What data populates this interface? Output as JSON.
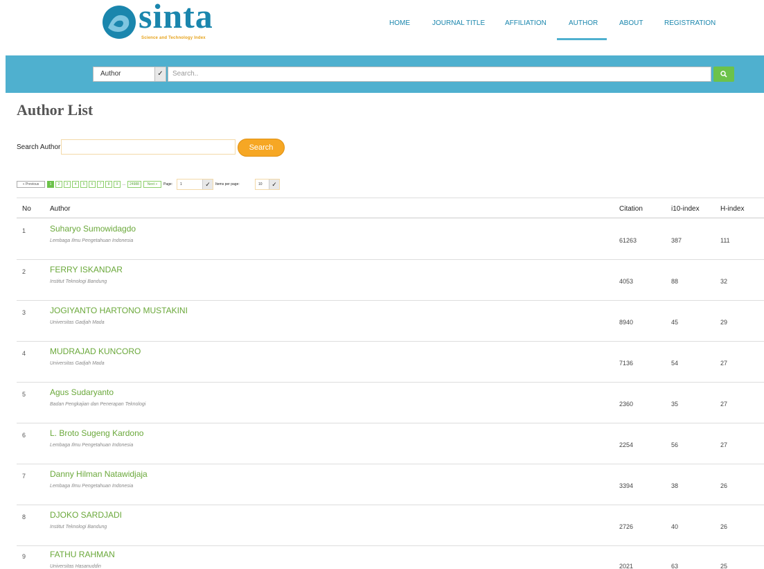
{
  "brand": {
    "name": "sinta",
    "tagline": "Science and Technology Index"
  },
  "nav": [
    "HOME",
    "JOURNAL TITLE",
    "AFFILIATION",
    "AUTHOR",
    "ABOUT",
    "REGISTRATION"
  ],
  "search_bar": {
    "scope": "Author",
    "placeholder": "Search.."
  },
  "page_title": "Author List",
  "search_author": {
    "label": "Search Author",
    "button": "Search"
  },
  "pagination": {
    "prev": "« Previous",
    "pages": [
      "1",
      "2",
      "3",
      "4",
      "5",
      "6",
      "7",
      "8",
      "9"
    ],
    "ellipsis": "...",
    "last": "24988",
    "next": "Next »",
    "page_label": "Page:",
    "page_value": "1",
    "per_page_label": "Items per page:",
    "per_page_value": "10"
  },
  "table": {
    "headers": {
      "no": "No",
      "author": "Author",
      "citation": "Citation",
      "i10": "i10-index",
      "h": "H-index"
    },
    "rows": [
      {
        "no": "1",
        "name": "Suharyo Sumowidagdo",
        "affiliation": "Lembaga Ilmu Pengetahuan Indonesia",
        "citation": "61263",
        "i10": "387",
        "h": "111"
      },
      {
        "no": "2",
        "name": "FERRY ISKANDAR",
        "affiliation": "Institut Teknologi Bandung",
        "citation": "4053",
        "i10": "88",
        "h": "32"
      },
      {
        "no": "3",
        "name": "JOGIYANTO HARTONO MUSTAKINI",
        "affiliation": "Universitas Gadjah Mada",
        "citation": "8940",
        "i10": "45",
        "h": "29"
      },
      {
        "no": "4",
        "name": "MUDRAJAD KUNCORO",
        "affiliation": "Universitas Gadjah Mada",
        "citation": "7136",
        "i10": "54",
        "h": "27"
      },
      {
        "no": "5",
        "name": "Agus Sudaryanto",
        "affiliation": "Badan Pengkajian dan Penerapan Teknologi",
        "citation": "2360",
        "i10": "35",
        "h": "27"
      },
      {
        "no": "6",
        "name": "L. Broto Sugeng Kardono",
        "affiliation": "Lembaga Ilmu Pengetahuan Indonesia",
        "citation": "2254",
        "i10": "56",
        "h": "27"
      },
      {
        "no": "7",
        "name": "Danny Hilman Natawidjaja",
        "affiliation": "Lembaga Ilmu Pengetahuan Indonesia",
        "citation": "3394",
        "i10": "38",
        "h": "26"
      },
      {
        "no": "8",
        "name": "DJOKO SARDJADI",
        "affiliation": "Institut Teknologi Bandung",
        "citation": "2726",
        "i10": "40",
        "h": "26"
      },
      {
        "no": "9",
        "name": "FATHU RAHMAN",
        "affiliation": "Universitas Hasanuddin",
        "citation": "2021",
        "i10": "63",
        "h": "25"
      }
    ]
  },
  "colors": {
    "brand_blue": "#1a86ad",
    "band": "#4fb0cf",
    "green": "#6cc24a",
    "orange": "#f6a724"
  }
}
